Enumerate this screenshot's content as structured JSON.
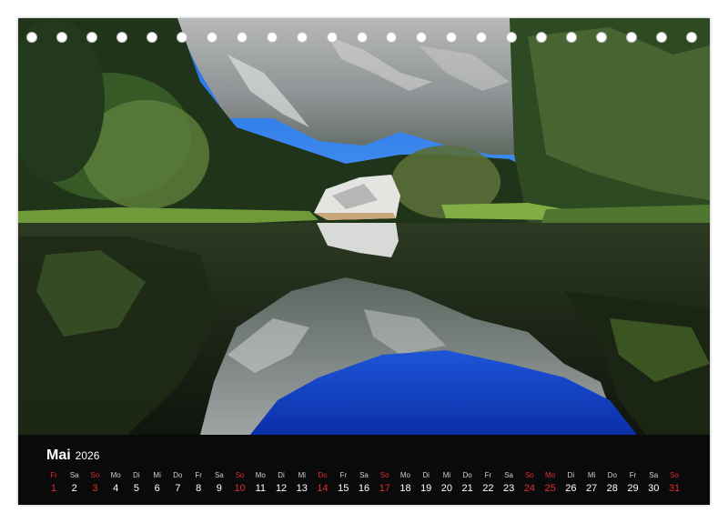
{
  "calendar": {
    "month": "Mai",
    "year": "2026",
    "accent_color": "#e02d2d",
    "days": [
      {
        "wd": "Fr",
        "d": "1",
        "red": true
      },
      {
        "wd": "Sa",
        "d": "2",
        "red": false
      },
      {
        "wd": "So",
        "d": "3",
        "red": true
      },
      {
        "wd": "Mo",
        "d": "4",
        "red": false
      },
      {
        "wd": "Di",
        "d": "5",
        "red": false
      },
      {
        "wd": "Mi",
        "d": "6",
        "red": false
      },
      {
        "wd": "Do",
        "d": "7",
        "red": false
      },
      {
        "wd": "Fr",
        "d": "8",
        "red": false
      },
      {
        "wd": "Sa",
        "d": "9",
        "red": false
      },
      {
        "wd": "So",
        "d": "10",
        "red": true
      },
      {
        "wd": "Mo",
        "d": "11",
        "red": false
      },
      {
        "wd": "Di",
        "d": "12",
        "red": false
      },
      {
        "wd": "Mi",
        "d": "13",
        "red": false
      },
      {
        "wd": "Do",
        "d": "14",
        "red": true
      },
      {
        "wd": "Fr",
        "d": "15",
        "red": false
      },
      {
        "wd": "Sa",
        "d": "16",
        "red": false
      },
      {
        "wd": "So",
        "d": "17",
        "red": true
      },
      {
        "wd": "Mo",
        "d": "18",
        "red": false
      },
      {
        "wd": "Di",
        "d": "19",
        "red": false
      },
      {
        "wd": "Mi",
        "d": "20",
        "red": false
      },
      {
        "wd": "Do",
        "d": "21",
        "red": false
      },
      {
        "wd": "Fr",
        "d": "22",
        "red": false
      },
      {
        "wd": "Sa",
        "d": "23",
        "red": false
      },
      {
        "wd": "So",
        "d": "24",
        "red": true
      },
      {
        "wd": "Mo",
        "d": "25",
        "red": true
      },
      {
        "wd": "Di",
        "d": "26",
        "red": false
      },
      {
        "wd": "Mi",
        "d": "27",
        "red": false
      },
      {
        "wd": "Do",
        "d": "28",
        "red": false
      },
      {
        "wd": "Fr",
        "d": "29",
        "red": false
      },
      {
        "wd": "Sa",
        "d": "30",
        "red": false
      },
      {
        "wd": "So",
        "d": "31",
        "red": true
      }
    ]
  }
}
